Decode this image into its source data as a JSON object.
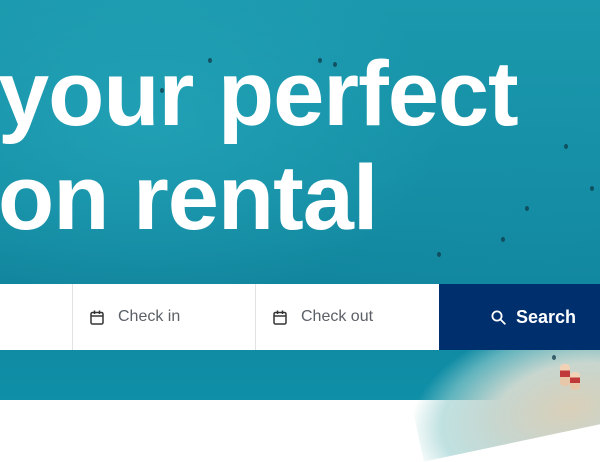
{
  "hero": {
    "title_line_1": "your perfect",
    "title_line_2": "on rental"
  },
  "search_bar": {
    "check_in_placeholder": "Check in",
    "check_out_placeholder": "Check out",
    "search_label": "Search"
  },
  "icons": {
    "check_in": "calendar-icon",
    "check_out": "calendar-icon",
    "search": "search-icon"
  },
  "colors": {
    "sea": "#1690a6",
    "search_button": "#002f6e",
    "field_background": "#ffffff",
    "placeholder_text": "#5b6067"
  }
}
